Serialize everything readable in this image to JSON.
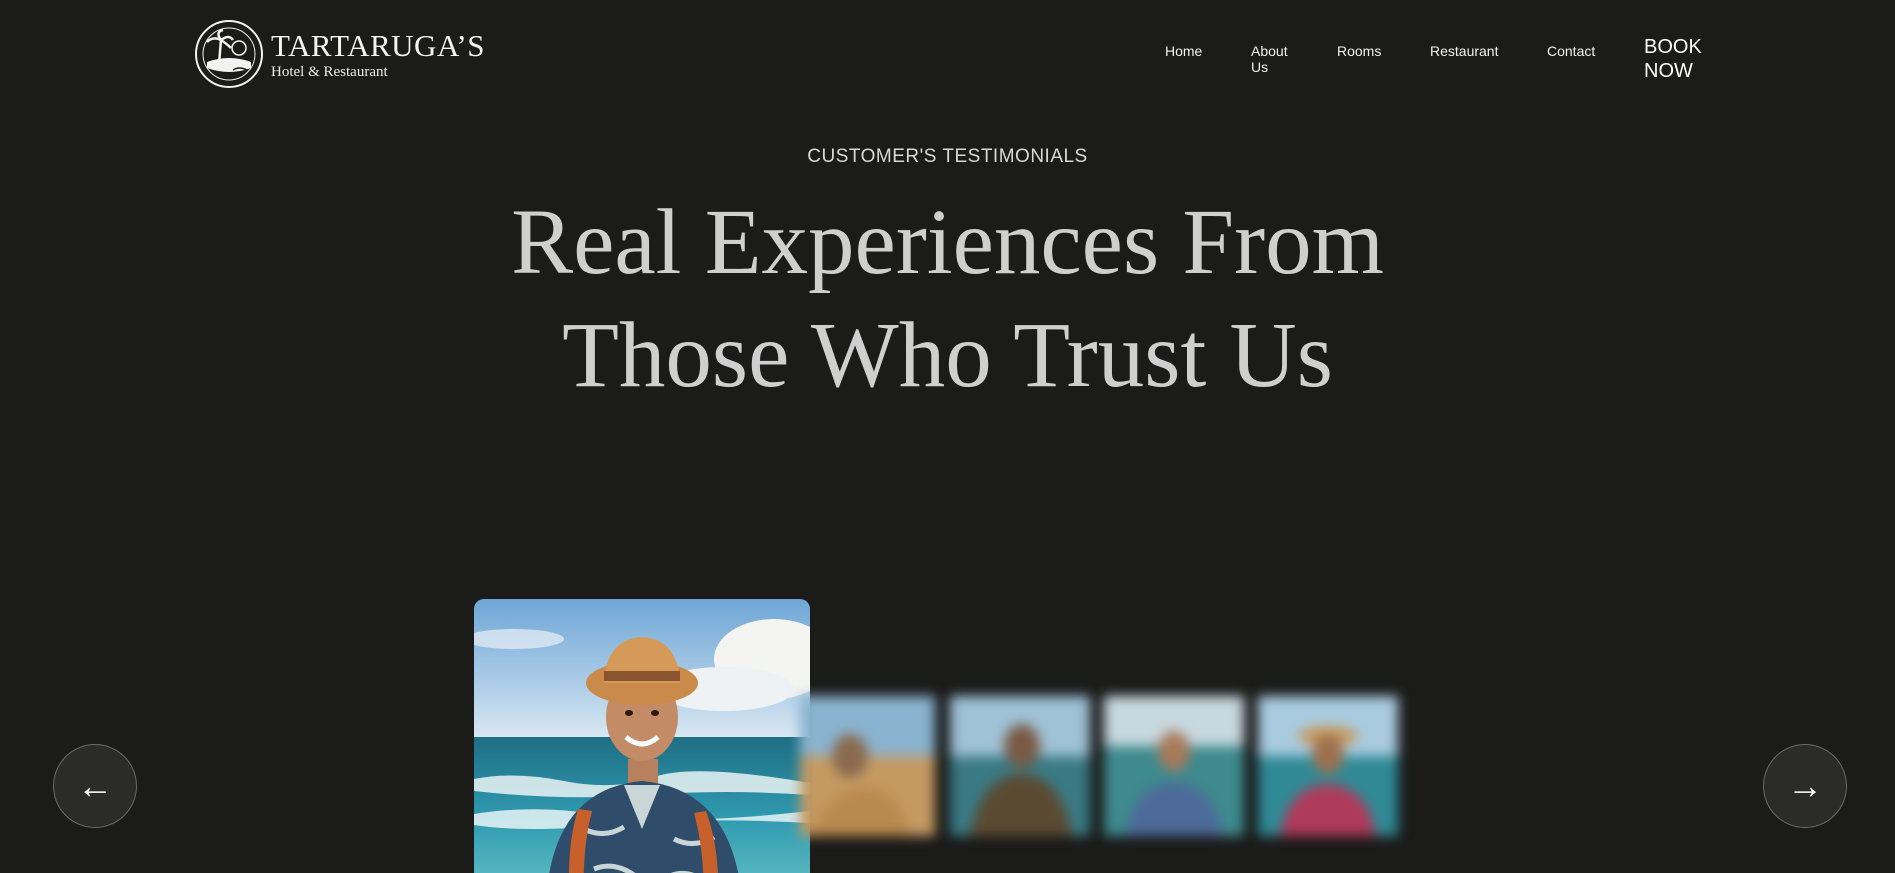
{
  "brand": {
    "name": "TARTARUGA’S",
    "tagline": "Hotel & Restaurant",
    "icon": "turtle-palm-badge-icon"
  },
  "nav": {
    "items": [
      "Home",
      "About Us",
      "Rooms",
      "Restaurant",
      "Contact"
    ],
    "book_now": "BOOK NOW"
  },
  "testimonials": {
    "eyebrow": "CUSTOMER'S TESTIMONIALS",
    "headline_line1": "Real Experiences From",
    "headline_line2": "Those Who Trust Us"
  },
  "carousel": {
    "prev_icon": "←",
    "next_icon": "→",
    "featured": "guest-portrait-man-straw-hat",
    "thumbnails": [
      "guest-portrait-blurred",
      "guest-portrait-blurred",
      "guest-portrait-blurred",
      "guest-portrait-blurred"
    ]
  },
  "colors": {
    "background": "#1b1b1a",
    "heading": "#cfcfcf",
    "button_bg": "#2b2b2a"
  }
}
